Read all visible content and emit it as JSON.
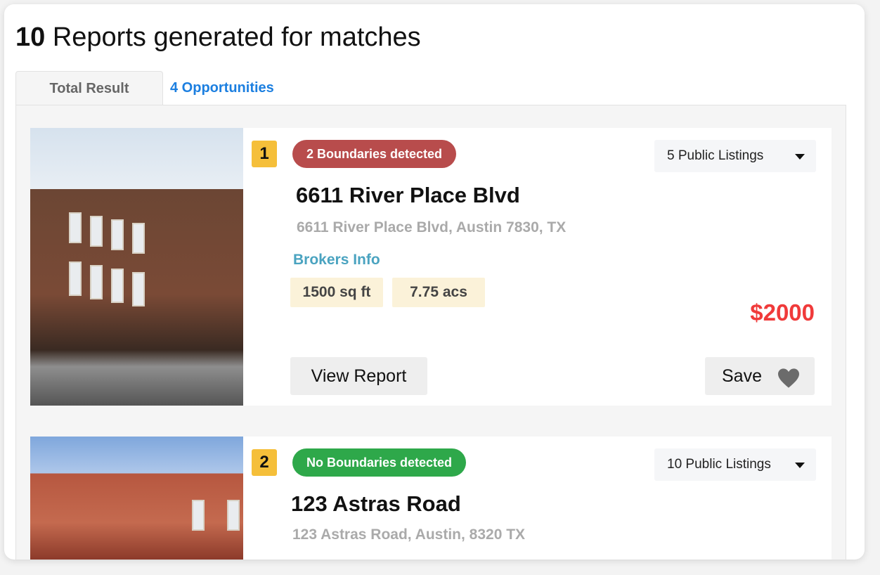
{
  "header": {
    "count": "10",
    "title_rest": " Reports generated for matches"
  },
  "tabs": [
    {
      "label": "Total Result"
    },
    {
      "label": "4 Opportunities"
    }
  ],
  "results": [
    {
      "rank": "1",
      "boundary_badge": "2 Boundaries detected",
      "badge_color": "#b84c4c",
      "listings": "5 Public Listings",
      "name": "6611  River Place Blvd",
      "address": "6611  River Place Blvd, Austin 7830, TX",
      "brokers_label": "Brokers Info",
      "area": "1500 sq ft",
      "acreage": "7.75 acs",
      "price": "$2000",
      "view_label": "View Report",
      "save_label": "Save"
    },
    {
      "rank": "2",
      "boundary_badge": "No Boundaries detected",
      "badge_color": "#2ea84a",
      "listings": "10 Public Listings",
      "name": "123 Astras Road",
      "address": "123 Astras Road, Austin, 8320 TX"
    }
  ]
}
